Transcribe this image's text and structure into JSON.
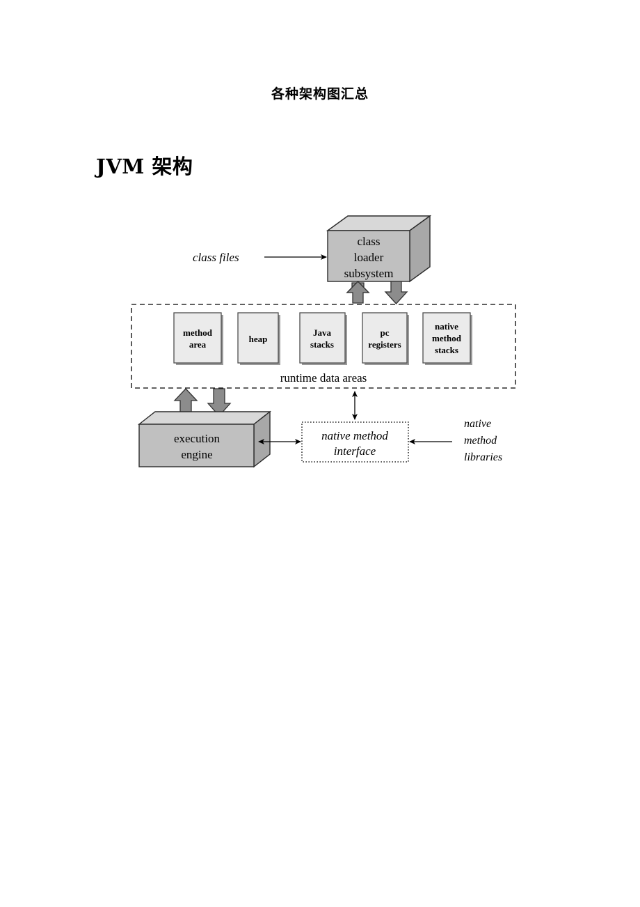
{
  "document": {
    "title": "各种架构图汇总",
    "section_heading": "JVM 架构"
  },
  "colors": {
    "cube_front": "#c0c0c0",
    "cube_top": "#d8d8d8",
    "cube_side": "#a8a8a8",
    "inner_box_fill": "#ebebeb",
    "inner_box_border": "#4d4d4d",
    "inner_box_shadow": "#9a9a9a",
    "block_arrow_fill": "#8c8c8c",
    "block_arrow_stroke": "#333333",
    "line": "#000000",
    "dashed_border": "#000000",
    "white": "#ffffff"
  },
  "diagram": {
    "name": "jvm-architecture-diagram",
    "class_files_label": "class files",
    "class_loader": {
      "lines": [
        "class",
        "loader",
        "subsystem"
      ]
    },
    "runtime_data_areas": {
      "caption": "runtime data areas",
      "boxes": [
        {
          "id": "method-area",
          "lines": [
            "method",
            "area"
          ]
        },
        {
          "id": "heap",
          "lines": [
            "heap"
          ]
        },
        {
          "id": "java-stacks",
          "lines": [
            "Java",
            "stacks"
          ]
        },
        {
          "id": "pc-registers",
          "lines": [
            "pc",
            "registers"
          ]
        },
        {
          "id": "native-method-stacks",
          "lines": [
            "native",
            "method",
            "stacks"
          ]
        }
      ]
    },
    "execution_engine": {
      "lines": [
        "execution",
        "engine"
      ]
    },
    "native_method_interface": {
      "lines": [
        "native method",
        "interface"
      ]
    },
    "native_method_libraries": {
      "lines": [
        "native",
        "method",
        "libraries"
      ]
    },
    "arrows": {
      "class_files_to_loader": "class-files-to-class-loader-arrow",
      "loader_up": "class-loader-up-block-arrow",
      "loader_down": "class-loader-down-block-arrow",
      "engine_up": "execution-engine-up-block-arrow",
      "engine_down": "execution-engine-down-block-arrow",
      "runtime_to_nmi": "runtime-data-areas-to-native-method-interface-arrow",
      "engine_to_nmi": "execution-engine-to-native-method-interface-arrow",
      "libraries_to_nmi": "native-method-libraries-to-interface-arrow"
    }
  }
}
